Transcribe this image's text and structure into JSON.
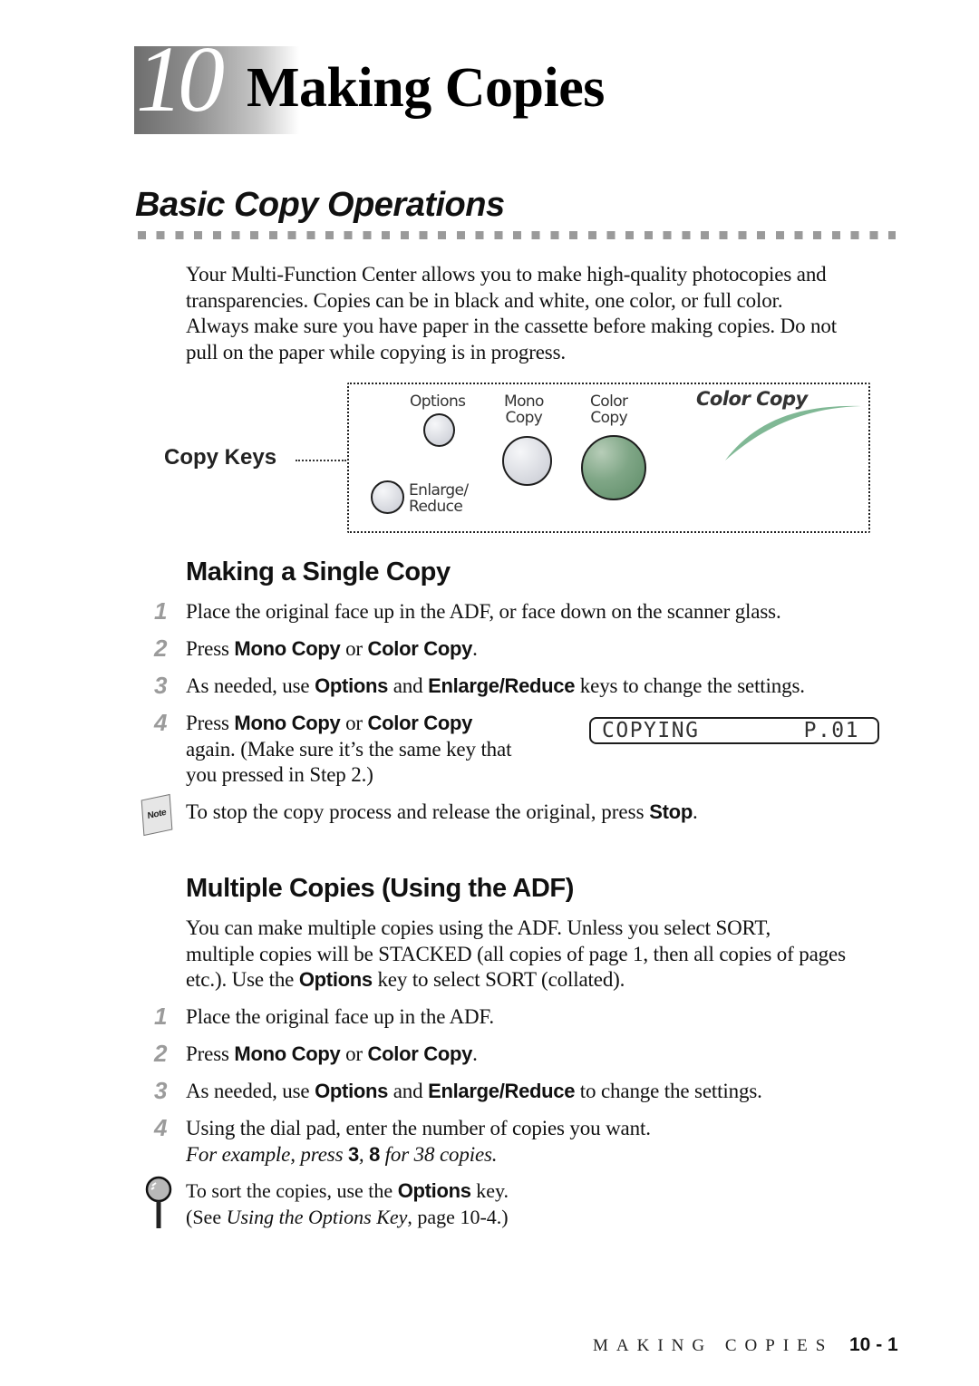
{
  "chapter": {
    "number": "10",
    "title": "Making Copies"
  },
  "section": {
    "title": "Basic Copy Operations"
  },
  "intro": {
    "lines": [
      "Your Multi-Function Center allows you to make high-quality photocopies and",
      "transparencies. Copies can be in black and white, one color, or full color.",
      "Always make sure you have paper in the cassette before making copies.  Do not",
      "pull on the paper while copying is in progress."
    ]
  },
  "panel": {
    "callout_label": "Copy Keys",
    "keys": {
      "options": "Options",
      "mono_line1": "Mono",
      "mono_line2": "Copy",
      "color_line1": "Color",
      "color_line2": "Copy",
      "enlarge_line1": "Enlarge/",
      "enlarge_line2": "Reduce"
    },
    "brand": "Color Copy",
    "colors": {
      "color_key": "#6e9a76",
      "swoosh": "#6fae86"
    }
  },
  "single_copy": {
    "heading": "Making a Single Copy",
    "steps": [
      {
        "num": "1",
        "text": "Place the original face up in the ADF, or face down on the scanner glass."
      },
      {
        "num": "2",
        "pre": "Press ",
        "b1": "Mono Copy",
        "mid": " or ",
        "b2": "Color Copy",
        "post": "."
      },
      {
        "num": "3",
        "pre": "As needed, use ",
        "b1": "Options",
        "mid": " and ",
        "b2": "Enlarge/Reduce",
        "post": " keys to change the settings."
      },
      {
        "num": "4",
        "pre": "Press ",
        "b1": "Mono Copy",
        "mid": " or ",
        "b2": "Color Copy",
        "line2": "again. (Make sure it’s the same key that",
        "line3": "you pressed in Step 2.)"
      }
    ],
    "lcd": {
      "left": "COPYING",
      "right": "P.01"
    },
    "note": {
      "icon_label": "Note",
      "pre": "To stop the copy process and release the original, press ",
      "b": "Stop",
      "post": "."
    }
  },
  "multiple_copies": {
    "heading": "Multiple Copies (Using the ADF)",
    "intro_line1": "You can make multiple copies using the ADF. Unless you select SORT,",
    "intro_line2": "multiple copies will be STACKED (all copies of page 1, then all copies of pages",
    "intro_line3_pre": "etc.). Use the ",
    "intro_line3_b": "Options",
    "intro_line3_post": " key to select SORT (collated).",
    "steps": [
      {
        "num": "1",
        "text": "Place the original face up in the ADF."
      },
      {
        "num": "2",
        "pre": "Press ",
        "b1": "Mono Copy",
        "mid": " or ",
        "b2": "Color Copy",
        "post": "."
      },
      {
        "num": "3",
        "pre": "As needed, use ",
        "b1": "Options",
        "mid": " and ",
        "b2": "Enlarge/Reduce",
        "post": " to change the settings."
      },
      {
        "num": "4",
        "text": "Using the dial pad, enter the number of copies you want.",
        "ex_pre": "For example, press ",
        "ex_b1": "3",
        "ex_sep": ", ",
        "ex_b2": "8",
        "ex_post": " for 38 copies."
      }
    ],
    "tip": {
      "line1_pre": "To sort the copies, use the ",
      "line1_b": "Options",
      "line1_post": " key.",
      "line2_pre": "(See ",
      "line2_i": "Using the Options Key",
      "line2_post": ", page 10-4.)"
    }
  },
  "footer": {
    "label": "MAKING COPIES",
    "page": "10 - 1"
  }
}
